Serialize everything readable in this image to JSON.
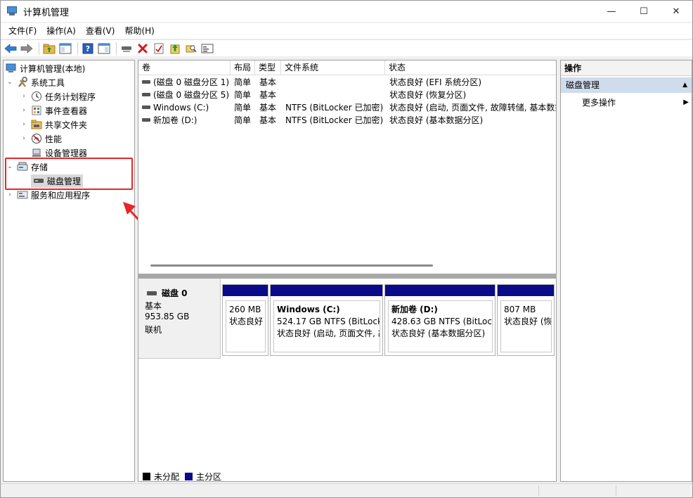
{
  "window": {
    "title": "计算机管理",
    "minimize": "—",
    "maximize": "☐",
    "close": "✕"
  },
  "menu": [
    "文件(F)",
    "操作(A)",
    "查看(V)",
    "帮助(H)"
  ],
  "tree": {
    "root": "计算机管理(本地)",
    "system_tools": "系统工具",
    "task_scheduler": "任务计划程序",
    "event_viewer": "事件查看器",
    "shared_folders": "共享文件夹",
    "performance": "性能",
    "device_manager": "设备管理器",
    "storage": "存储",
    "disk_management": "磁盘管理",
    "services_apps": "服务和应用程序"
  },
  "list": {
    "headers": [
      "卷",
      "布局",
      "类型",
      "文件系统",
      "状态"
    ],
    "rows": [
      {
        "volume": "(磁盘 0 磁盘分区 1)",
        "layout": "简单",
        "type": "基本",
        "fs": "",
        "status": "状态良好 (EFI 系统分区)"
      },
      {
        "volume": "(磁盘 0 磁盘分区 5)",
        "layout": "简单",
        "type": "基本",
        "fs": "",
        "status": "状态良好 (恢复分区)"
      },
      {
        "volume": "Windows (C:)",
        "layout": "简单",
        "type": "基本",
        "fs": "NTFS (BitLocker 已加密)",
        "status": "状态良好 (启动, 页面文件, 故障转储, 基本数据"
      },
      {
        "volume": "新加卷 (D:)",
        "layout": "简单",
        "type": "基本",
        "fs": "NTFS (BitLocker 已加密)",
        "status": "状态良好 (基本数据分区)"
      }
    ]
  },
  "disk": {
    "name": "磁盘 0",
    "type": "基本",
    "size": "953.85 GB",
    "state": "联机",
    "partitions": [
      {
        "title": "",
        "line1": "260 MB",
        "line2": "状态良好"
      },
      {
        "title": "Windows  (C:)",
        "line1": "524.17 GB NTFS (BitLocke",
        "line2": "状态良好 (启动, 页面文件, 故"
      },
      {
        "title": "新加卷  (D:)",
        "line1": "428.63 GB NTFS (BitLock",
        "line2": "状态良好 (基本数据分区)"
      },
      {
        "title": "",
        "line1": "807 MB",
        "line2": "状态良好 (恢"
      }
    ]
  },
  "legend": {
    "unallocated": "未分配",
    "primary": "主分区",
    "unallocated_color": "#000000",
    "primary_color": "#0a0a8a"
  },
  "actions": {
    "title": "操作",
    "section": "磁盘管理",
    "more": "更多操作"
  },
  "annotation_color": "#e8262a"
}
